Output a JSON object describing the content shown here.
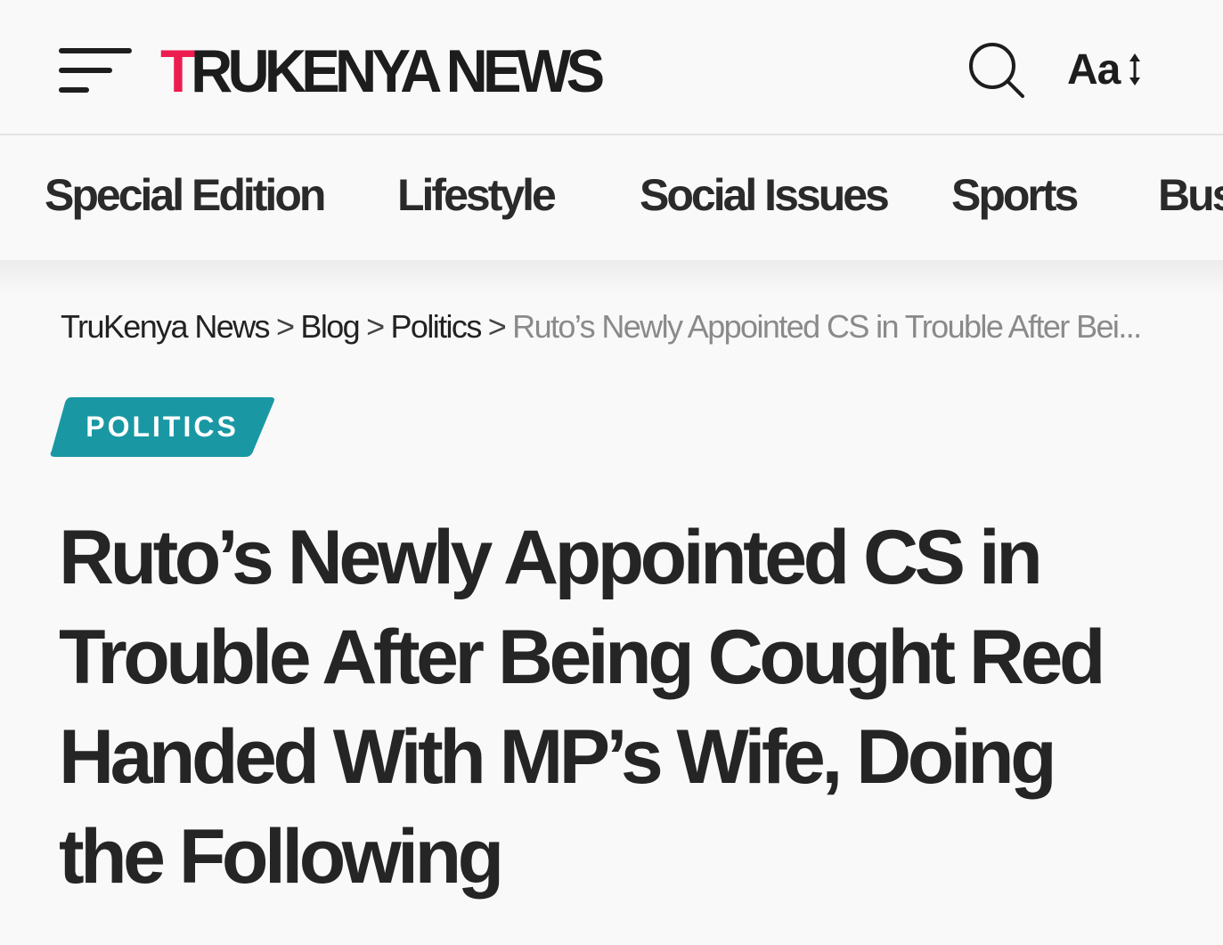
{
  "header": {
    "logo_accent": "T",
    "logo_rest": "RUKENYA NEWS",
    "font_size_label": "Aa",
    "accent_color": "#ec1c4f"
  },
  "icons": {
    "menu": "hamburger-menu-icon",
    "search": "search-icon",
    "font_resize": "resize-arrows-icon"
  },
  "nav": {
    "items": [
      {
        "label": "Special Edition"
      },
      {
        "label": "Lifestyle"
      },
      {
        "label": "Social Issues"
      },
      {
        "label": "Sports"
      },
      {
        "label": "Bus"
      }
    ]
  },
  "breadcrumb": {
    "items": [
      {
        "label": "TruKenya News"
      },
      {
        "label": "Blog"
      },
      {
        "label": "Politics"
      }
    ],
    "separator": ">",
    "current": "Ruto’s Newly Appointed CS in Trouble After Bei..."
  },
  "article": {
    "category": "POLITICS",
    "category_color": "#1998a4",
    "title": "Ruto’s Newly Appointed CS in Trouble After Being Cought Red Handed With MP’s Wife, Doing the Following"
  }
}
